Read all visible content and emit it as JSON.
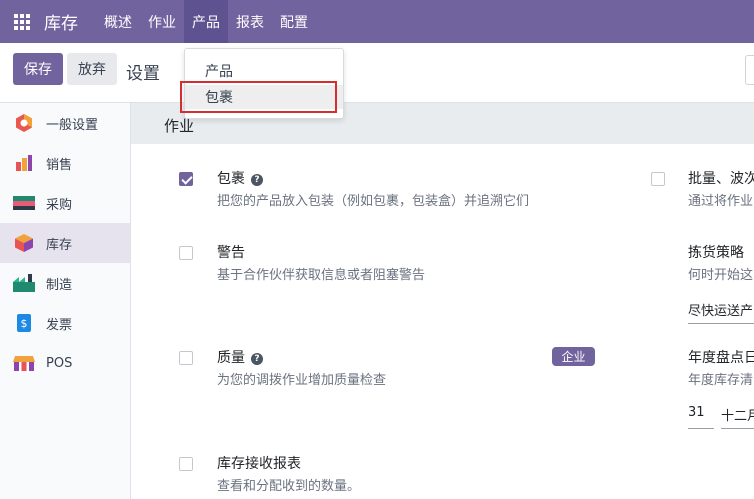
{
  "navbar": {
    "app_name": "库存",
    "menu": [
      "概述",
      "作业",
      "产品",
      "报表",
      "配置"
    ],
    "active_menu": "产品"
  },
  "control": {
    "save_label": "保存",
    "discard_label": "放弃",
    "title": "设置"
  },
  "sidebar": {
    "items": [
      {
        "label": "一般设置",
        "icon": "general-settings-icon"
      },
      {
        "label": "销售",
        "icon": "sales-icon"
      },
      {
        "label": "采购",
        "icon": "purchase-icon"
      },
      {
        "label": "库存",
        "icon": "inventory-icon"
      },
      {
        "label": "制造",
        "icon": "manufacturing-icon"
      },
      {
        "label": "发票",
        "icon": "invoicing-icon"
      },
      {
        "label": "POS",
        "icon": "pos-icon"
      }
    ],
    "active": "库存"
  },
  "main": {
    "section_title": "作业",
    "settings": [
      {
        "title": "包裹",
        "description": "把您的产品放入包装（例如包裹，包装盒）并追溯它们",
        "checked": true,
        "help": true
      },
      {
        "title": "警告",
        "description": "基于合作伙伴获取信息或者阻塞警告",
        "checked": false
      },
      {
        "title": "质量",
        "description": "为您的调拨作业增加质量检查",
        "checked": false,
        "help": true,
        "badge": "企业"
      },
      {
        "title": "库存接收报表",
        "description": "查看和分配收到的数量。",
        "checked": false
      }
    ],
    "right_settings": [
      {
        "title": "批量、波次",
        "description": "通过将作业",
        "checked": false
      },
      {
        "title": "拣货策略",
        "description": "何时开始这",
        "select_value": "尽快运送产"
      },
      {
        "title": "年度盘点日",
        "description": "年度库存清",
        "day_value": "31",
        "month_value": "十二月"
      }
    ]
  },
  "dropdown": {
    "items": [
      "产品",
      "包裹"
    ],
    "highlighted": "包裹"
  },
  "colors": {
    "brand": "#71639e",
    "highlight_border": "#d32f2f"
  }
}
